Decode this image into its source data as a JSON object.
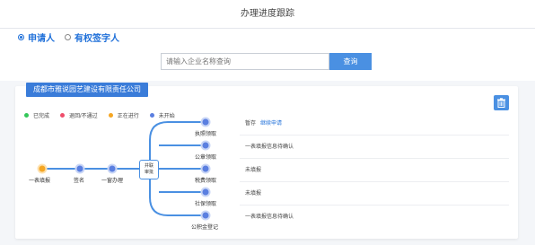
{
  "header": {
    "title": "办理进度跟踪"
  },
  "applicant": {
    "options": [
      {
        "label": "申请人",
        "checked": true
      },
      {
        "label": "有权签字人",
        "checked": false
      }
    ]
  },
  "search": {
    "placeholder": "请输入企业名称查询",
    "button_label": "查询"
  },
  "card": {
    "company_name": "成都市雅说园艺建设有限责任公司",
    "legend": [
      {
        "label": "已完成",
        "color": "#34c759"
      },
      {
        "label": "退回/不通过",
        "color": "#ef4d6b"
      },
      {
        "label": "正在进行",
        "color": "#f5a623"
      },
      {
        "label": "未开始",
        "color": "#5b7fe0"
      }
    ],
    "flow": {
      "main_steps": [
        "一表填报",
        "签名",
        "一窗办理"
      ],
      "hub_label_line1": "并联",
      "hub_label_line2": "审批",
      "branches": [
        "执照领取",
        "公章领取",
        "税费领取",
        "社保领取",
        "公积金登记"
      ]
    },
    "statuses": [
      {
        "text": "暂存",
        "link": "继续申请"
      },
      {
        "text": "一表填报信息待确认",
        "link": ""
      },
      {
        "text": "未填报",
        "link": ""
      },
      {
        "text": "未填报",
        "link": ""
      },
      {
        "text": "一表填报信息待确认",
        "link": ""
      }
    ]
  }
}
